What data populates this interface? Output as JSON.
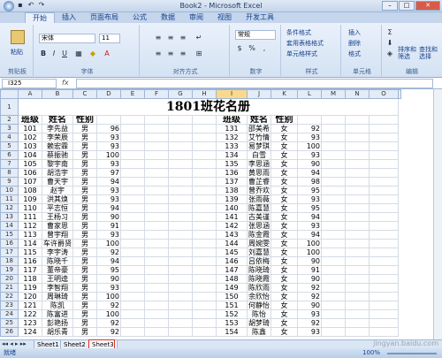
{
  "window": {
    "title": "Book2 - Microsoft Excel"
  },
  "tabs": [
    "开始",
    "插入",
    "页面布局",
    "公式",
    "数据",
    "审阅",
    "视图",
    "开发工具"
  ],
  "ribbon": {
    "clipboard": {
      "label": "剪贴板",
      "paste": "粘贴"
    },
    "font": {
      "label": "字体",
      "name": "宋体",
      "size": "11"
    },
    "align": {
      "label": "对齐方式"
    },
    "number": {
      "label": "数字",
      "format": "常规"
    },
    "styles": {
      "label": "样式",
      "items": [
        "条件格式",
        "套用表格格式",
        "单元格样式"
      ]
    },
    "cells": {
      "label": "单元格",
      "items": [
        "插入",
        "删除",
        "格式"
      ]
    },
    "edit": {
      "label": "编辑",
      "sort": "排序和\n筛选",
      "find": "查找和\n选择"
    }
  },
  "formula": {
    "cell": "I325",
    "fx": "fx"
  },
  "columns": [
    "A",
    "B",
    "C",
    "D",
    "E",
    "F",
    "G",
    "H",
    "I",
    "J",
    "K",
    "L",
    "M",
    "N",
    "O"
  ],
  "sheet_title": "1801班花名册",
  "headers": [
    "班级",
    "姓名",
    "性别"
  ],
  "left_rows": [
    [
      "101",
      "李先益",
      "男",
      "96"
    ],
    [
      "102",
      "李荣辰",
      "男",
      "93"
    ],
    [
      "103",
      "赖宏霖",
      "男",
      "93"
    ],
    [
      "104",
      "蔡振驰",
      "男",
      "100"
    ],
    [
      "105",
      "黎宇南",
      "男",
      "93"
    ],
    [
      "106",
      "胡浩宇",
      "男",
      "97"
    ],
    [
      "107",
      "曹天宇",
      "男",
      "94"
    ],
    [
      "108",
      "赵宇",
      "男",
      "93"
    ],
    [
      "109",
      "洪其焕",
      "男",
      "93"
    ],
    [
      "110",
      "平志恒",
      "男",
      "94"
    ],
    [
      "111",
      "王杨习",
      "男",
      "90"
    ],
    [
      "112",
      "曹家恩",
      "男",
      "91"
    ],
    [
      "113",
      "曾宇翔",
      "男",
      "93"
    ],
    [
      "114",
      "车许爵贤",
      "男",
      "100"
    ],
    [
      "115",
      "李宇涛",
      "男",
      "92"
    ],
    [
      "116",
      "陈晓千",
      "男",
      "94"
    ],
    [
      "117",
      "董帝豪",
      "男",
      "95"
    ],
    [
      "118",
      "王明逵",
      "男",
      "90"
    ],
    [
      "119",
      "李智翔",
      "男",
      "93"
    ],
    [
      "120",
      "周琳琦",
      "男",
      "100"
    ],
    [
      "121",
      "陈凯",
      "男",
      "92"
    ],
    [
      "122",
      "陈富进",
      "男",
      "100"
    ],
    [
      "123",
      "彭艳扬",
      "男",
      "92"
    ],
    [
      "124",
      "胡乐青",
      "男",
      "92"
    ]
  ],
  "right_rows": [
    [
      "131",
      "邵美希",
      "女",
      "92"
    ],
    [
      "132",
      "艾竹情",
      "女",
      "93"
    ],
    [
      "133",
      "易梦琪",
      "女",
      "100"
    ],
    [
      "134",
      "白雪",
      "女",
      "93"
    ],
    [
      "135",
      "李思涵",
      "女",
      "90"
    ],
    [
      "136",
      "黄思雨",
      "女",
      "94"
    ],
    [
      "137",
      "曹芷睿",
      "女",
      "98"
    ],
    [
      "138",
      "曾乔欢",
      "女",
      "95"
    ],
    [
      "139",
      "张雨薇",
      "女",
      "93"
    ],
    [
      "140",
      "陈嘉慧",
      "女",
      "95"
    ],
    [
      "141",
      "古美谨",
      "女",
      "94"
    ],
    [
      "142",
      "张思涵",
      "女",
      "93"
    ],
    [
      "143",
      "陈金霞",
      "女",
      "94"
    ],
    [
      "144",
      "周婉雯",
      "女",
      "100"
    ],
    [
      "145",
      "刘嘉慧",
      "女",
      "100"
    ],
    [
      "146",
      "吕依梅",
      "女",
      "90"
    ],
    [
      "147",
      "陈晓琦",
      "女",
      "91"
    ],
    [
      "148",
      "陈晓霞",
      "女",
      "90"
    ],
    [
      "149",
      "陈欣雨",
      "女",
      "92"
    ],
    [
      "150",
      "余欣怡",
      "女",
      "92"
    ],
    [
      "151",
      "何静怡",
      "女",
      "90"
    ],
    [
      "152",
      "陈怡",
      "女",
      "93"
    ],
    [
      "153",
      "胡梦琦",
      "女",
      "92"
    ],
    [
      "154",
      "陈鑫",
      "女",
      "93"
    ]
  ],
  "row_numbers": [
    "1",
    "2",
    "3",
    "4",
    "5",
    "6",
    "7",
    "8",
    "9",
    "10",
    "11",
    "12",
    "13",
    "14",
    "15",
    "16",
    "17",
    "18",
    "19",
    "20",
    "21",
    "22",
    "23",
    "24",
    "25",
    "26"
  ],
  "sheettabs": [
    "Sheet1",
    "Sheet2",
    "Sheet3"
  ],
  "status": {
    "ready": "就绪",
    "zoom": "100%"
  },
  "watermark": "jingyan.baidu.com"
}
